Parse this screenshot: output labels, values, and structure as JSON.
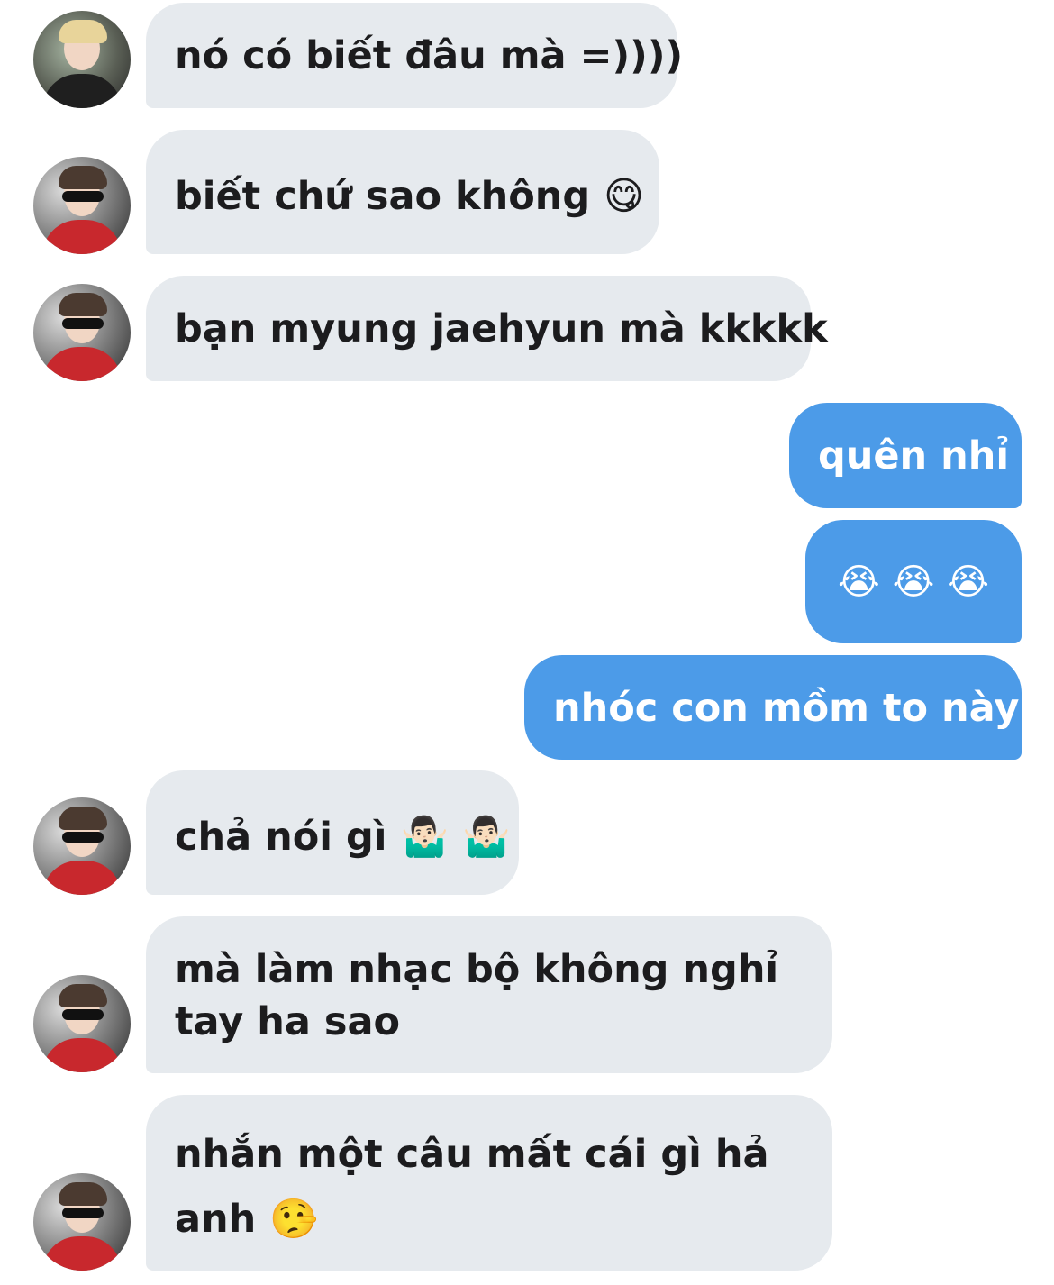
{
  "messages": [
    {
      "side": "in",
      "lines": [
        "nó có biết đâu mà =))))"
      ]
    },
    {
      "side": "in",
      "lines": [
        "biết chứ sao không 😋"
      ]
    },
    {
      "side": "in",
      "lines": [
        "bạn myung jaehyun mà kkkkk"
      ]
    },
    {
      "side": "out",
      "lines": [
        "quên nhỉ"
      ]
    },
    {
      "side": "out",
      "lines": [
        "😭 😭 😭"
      ]
    },
    {
      "side": "out",
      "lines": [
        "nhóc con mồm to này"
      ]
    },
    {
      "side": "in",
      "lines": [
        "chả nói gì 🤷🏻‍♂️ 🤷🏻‍♂️"
      ]
    },
    {
      "side": "in",
      "lines": [
        "mà làm nhạc bộ không nghỉ",
        "tay ha sao"
      ]
    },
    {
      "side": "in",
      "lines": [
        "nhắn một câu mất cái gì hả",
        "anh 🤥"
      ]
    }
  ],
  "colors": {
    "incoming_bubble": "#e6eaee",
    "outgoing_bubble": "#4c9be8"
  }
}
